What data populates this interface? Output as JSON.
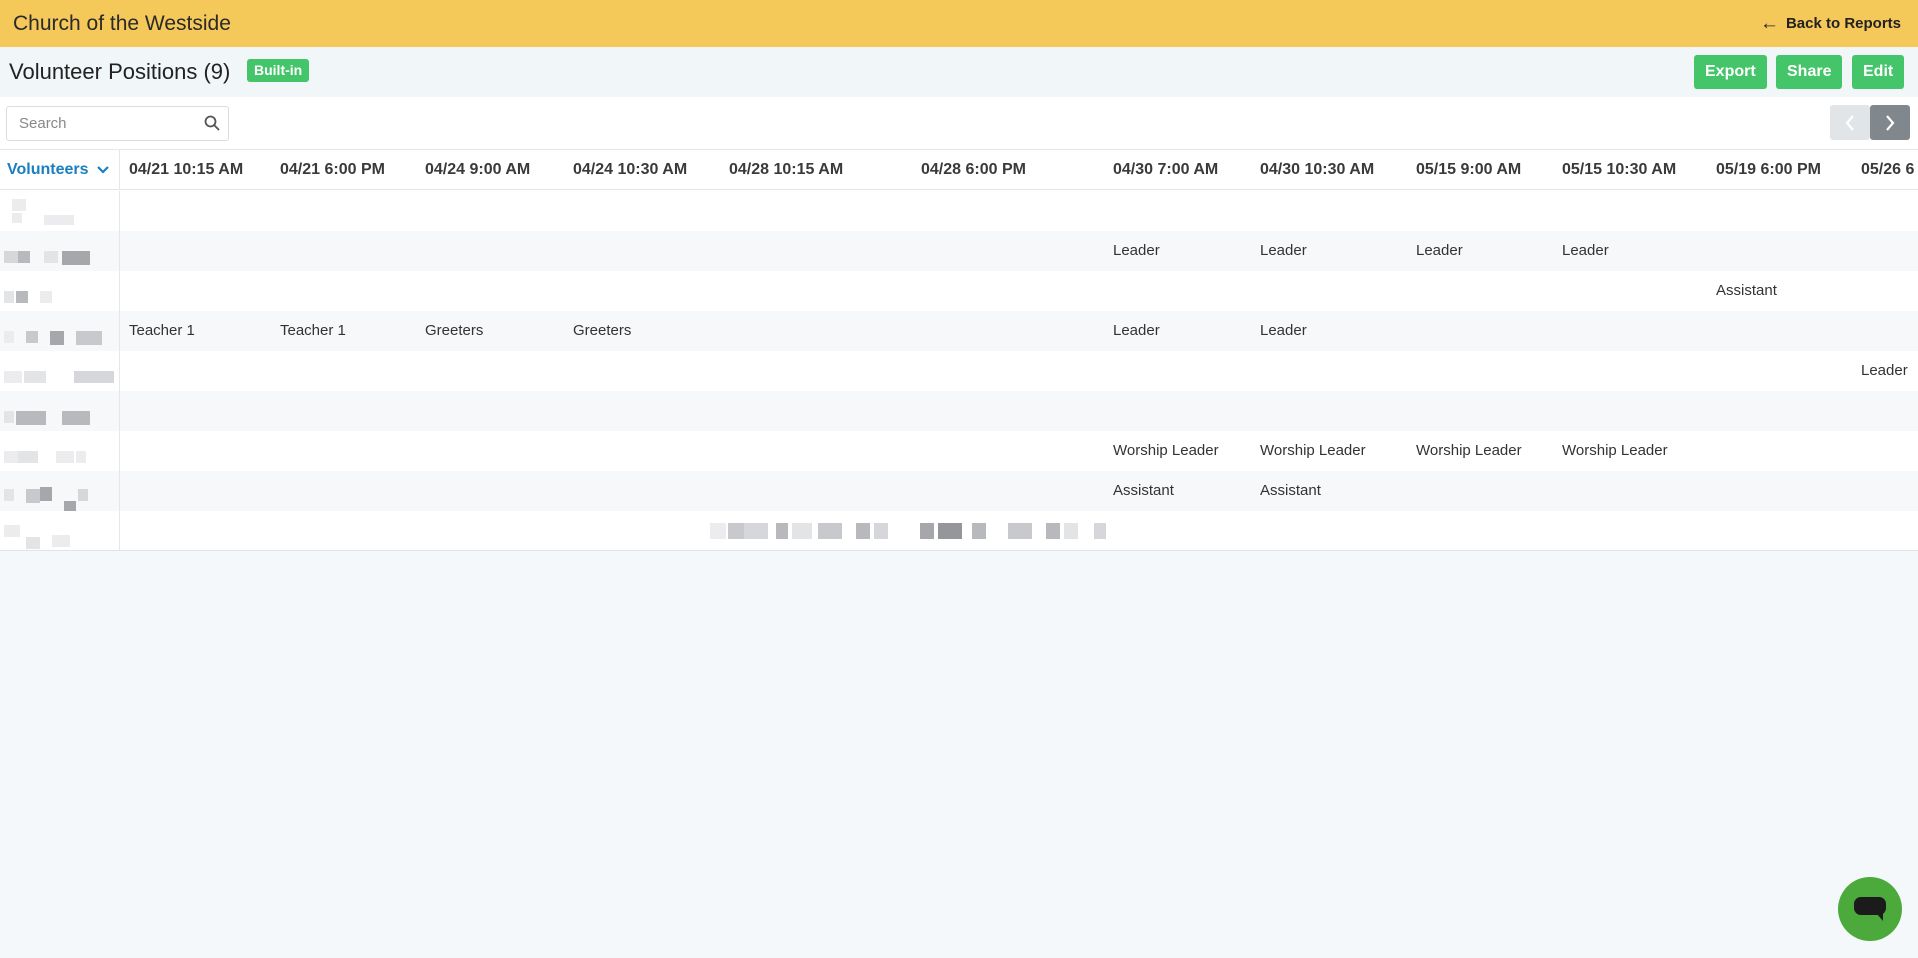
{
  "header": {
    "org_name": "Church of the Westside",
    "back_label": "Back to Reports"
  },
  "report": {
    "title": "Volunteer Positions (9)",
    "badge": "Built-in",
    "export_label": "Export",
    "share_label": "Share",
    "edit_label": "Edit"
  },
  "search": {
    "placeholder": "Search",
    "value": ""
  },
  "grid": {
    "first_col_label": "Volunteers",
    "columns": [
      "04/21 10:15 AM",
      "04/21 6:00 PM",
      "04/24 9:00 AM",
      "04/24 10:30 AM",
      "04/28 10:15 AM",
      "04/28 6:00 PM",
      "04/30 7:00 AM",
      "04/30 10:30 AM",
      "05/15 9:00 AM",
      "05/15 10:30 AM",
      "05/19 6:00 PM",
      "05/26 6"
    ],
    "rows": [
      [
        "",
        "",
        "",
        "",
        "",
        "",
        "",
        "",
        "",
        "",
        "",
        ""
      ],
      [
        "",
        "",
        "",
        "",
        "",
        "",
        "Leader",
        "Leader",
        "Leader",
        "Leader",
        "",
        ""
      ],
      [
        "",
        "",
        "",
        "",
        "",
        "",
        "",
        "",
        "",
        "",
        "Assistant",
        ""
      ],
      [
        "Teacher 1",
        "Teacher 1",
        "Greeters",
        "Greeters",
        "",
        "",
        "Leader",
        "Leader",
        "",
        "",
        "",
        ""
      ],
      [
        "",
        "",
        "",
        "",
        "",
        "",
        "",
        "",
        "",
        "",
        "",
        "Leader"
      ],
      [
        "",
        "",
        "",
        "",
        "",
        "",
        "",
        "",
        "",
        "",
        "",
        ""
      ],
      [
        "",
        "",
        "",
        "",
        "",
        "",
        "Worship Leader",
        "Worship Leader",
        "Worship Leader",
        "Worship Leader",
        "",
        ""
      ],
      [
        "",
        "",
        "",
        "",
        "",
        "",
        "Assistant",
        "Assistant",
        "",
        "",
        "",
        ""
      ],
      [
        "",
        "",
        "",
        "",
        "",
        "",
        "",
        "",
        "",
        "",
        "",
        ""
      ]
    ]
  },
  "colors": {
    "topbar": "#f5c85a",
    "accent_green": "#45c56a",
    "link_blue": "#1a7fc0",
    "chat_green": "#4caa3c"
  },
  "icons": {
    "back": "arrow-left-icon",
    "search": "search-icon",
    "prev": "chevron-left-icon",
    "next": "chevron-right-icon",
    "sort": "chevron-down-icon",
    "chat": "chat-bubble-icon"
  }
}
